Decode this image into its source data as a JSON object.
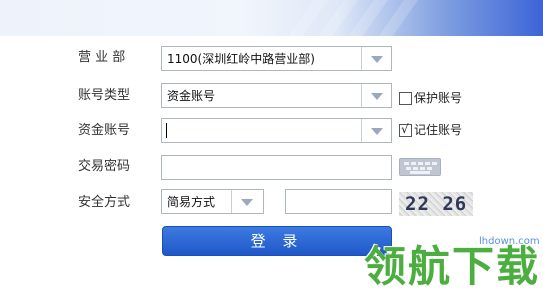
{
  "form": {
    "branch_label": "营 业 部",
    "branch_value": "1100(深圳红岭中路营业部)",
    "account_type_label": "账号类型",
    "account_type_value": "资金账号",
    "protect_account_label": "保护账号",
    "protect_account_checked": false,
    "fund_account_label": "资金账号",
    "fund_account_value": "",
    "remember_account_label": "记住账号",
    "remember_account_checked": true,
    "check_mark": "√",
    "password_label": "交易密码",
    "password_value": "",
    "security_label": "安全方式",
    "security_value": "简易方式",
    "captcha_input_value": "",
    "captcha_text": "22 26",
    "login_label": "登 录"
  },
  "watermark": {
    "url": "lhdown.com",
    "text": "领航下载"
  },
  "colors": {
    "accent": "#2663d0",
    "watermark_green": "#4cae3f",
    "banner_blue": "#3c64d8"
  }
}
